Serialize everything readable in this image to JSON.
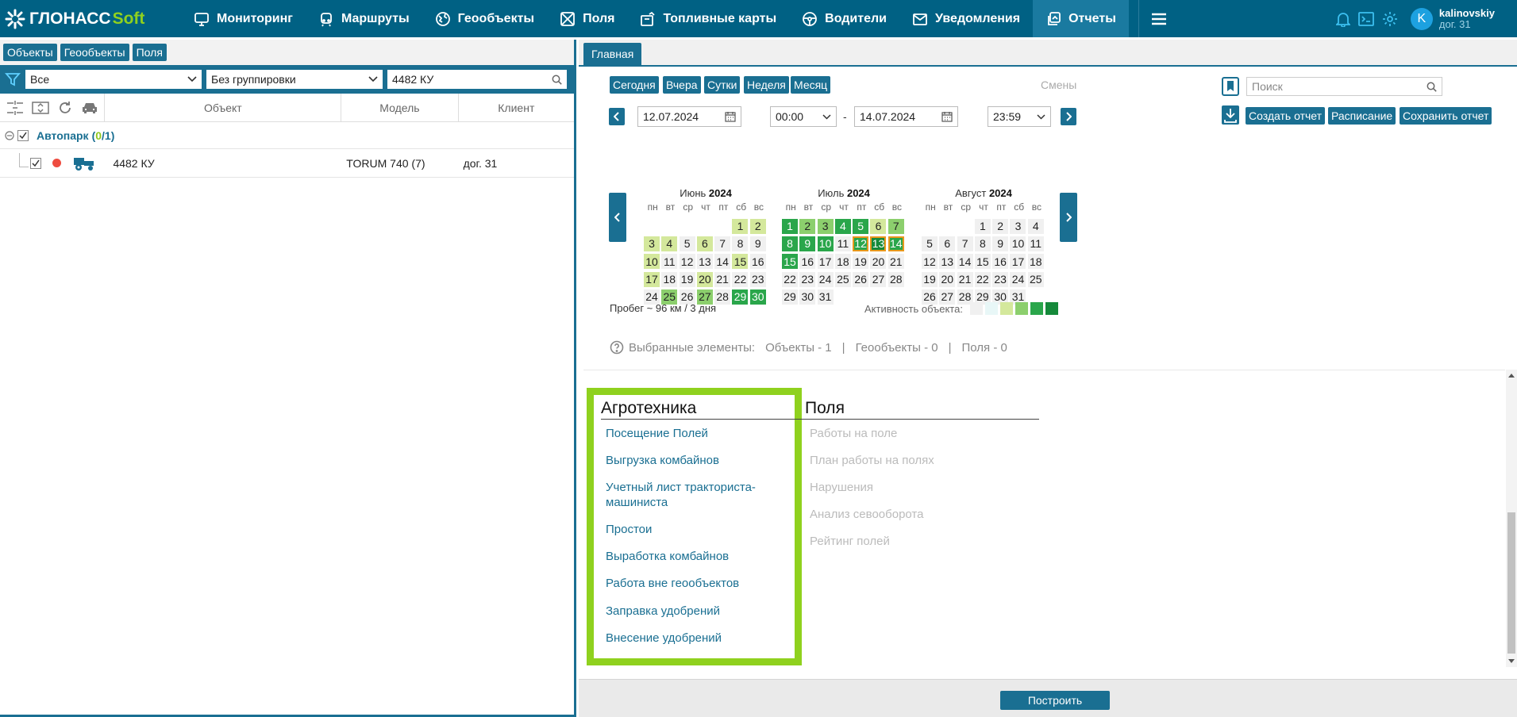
{
  "header": {
    "logo_part1": "ГЛОНАСС",
    "logo_part2": "Soft",
    "nav": [
      {
        "label": "Мониторинг",
        "icon": "monitoring-icon"
      },
      {
        "label": "Маршруты",
        "icon": "routes-icon"
      },
      {
        "label": "Геообъекты",
        "icon": "geoobjects-icon"
      },
      {
        "label": "Поля",
        "icon": "fields-icon"
      },
      {
        "label": "Топливные карты",
        "icon": "fuel-card-icon"
      },
      {
        "label": "Водители",
        "icon": "drivers-icon"
      },
      {
        "label": "Уведомления",
        "icon": "notifications-icon"
      },
      {
        "label": "Отчеты",
        "icon": "reports-icon"
      }
    ],
    "user_initial": "K",
    "user_name": "kalinovskiy",
    "account": "дог. 31"
  },
  "left": {
    "tabs": [
      "Объекты",
      "Геообъекты",
      "Поля"
    ],
    "filter": {
      "select1": "Все",
      "select2": "Без группировки",
      "search": "4482 КУ"
    },
    "columns": {
      "object": "Объект",
      "model": "Модель",
      "client": "Клиент"
    },
    "group": {
      "name": "Автопарк",
      "count_open": "(",
      "count_sel": "0",
      "count_sep": "/",
      "count_total": "1",
      "count_close": ")"
    },
    "rows": [
      {
        "object": "4482 КУ",
        "model": "TORUM 740 (7)",
        "client": "дог. 31"
      }
    ]
  },
  "right": {
    "tab": "Главная",
    "quick": [
      "Сегодня",
      "Вчера",
      "Сутки",
      "Неделя",
      "Месяц"
    ],
    "shifts": "Смены",
    "search_placeholder": "Поиск",
    "actions": [
      "Создать отчет",
      "Расписание",
      "Сохранить отчет"
    ],
    "date_from": "12.07.2024",
    "time_from": "00:00",
    "dash": "-",
    "date_to": "14.07.2024",
    "time_to": "23:59",
    "dow": [
      "пн",
      "вт",
      "ср",
      "чт",
      "пт",
      "сб",
      "вс"
    ],
    "months": [
      {
        "name": "Июнь",
        "year": "2024",
        "offset": 5,
        "days": 30,
        "levels": {
          "1": 1,
          "2": 1,
          "3": 1,
          "4": 1,
          "6": 1,
          "10": 1,
          "15": 1,
          "17": 1,
          "20": 1,
          "25": 2,
          "27": 2,
          "29": 3,
          "30": 3
        }
      },
      {
        "name": "Июль",
        "year": "2024",
        "offset": 0,
        "days": 31,
        "levels": {
          "1": 3,
          "2": 2,
          "3": 2,
          "4": 3,
          "5": 3,
          "6": 1,
          "7": 2,
          "8": 3,
          "9": 3,
          "10": 3,
          "12": 3,
          "13": 4,
          "14": 3,
          "15": 3
        },
        "selected": [
          12,
          13,
          14
        ]
      },
      {
        "name": "Август",
        "year": "2024",
        "offset": 3,
        "days": 31,
        "levels": {}
      }
    ],
    "mileage": "Пробег ~ 96 км / 3 дня",
    "activity_label": "Активность объекта:",
    "legend_colors": [
      "#f0f0f0",
      "#e8f7f7",
      "#d4e89c",
      "#8ccf6d",
      "#2aa64b",
      "#15893a"
    ],
    "selected_label": "Выбранные элементы:",
    "selected_objects": "Объекты - 1",
    "sep": "|",
    "selected_geo": "Геообъекты - 0",
    "selected_fields": "Поля - 0",
    "section1_title": "Агротехника",
    "section1_items": [
      "Посещение Полей",
      "Выгрузка комбайнов",
      "Учетный лист тракториста-машиниста",
      "Простои",
      "Выработка комбайнов",
      "Работа вне геообъектов",
      "Заправка удобрений",
      "Внесение удобрений"
    ],
    "section2_title": "Поля",
    "section2_items": [
      "Работы на поле",
      "План работы на полях",
      "Нарушения",
      "Анализ севооборота",
      "Рейтинг полей"
    ],
    "build": "Построить"
  }
}
